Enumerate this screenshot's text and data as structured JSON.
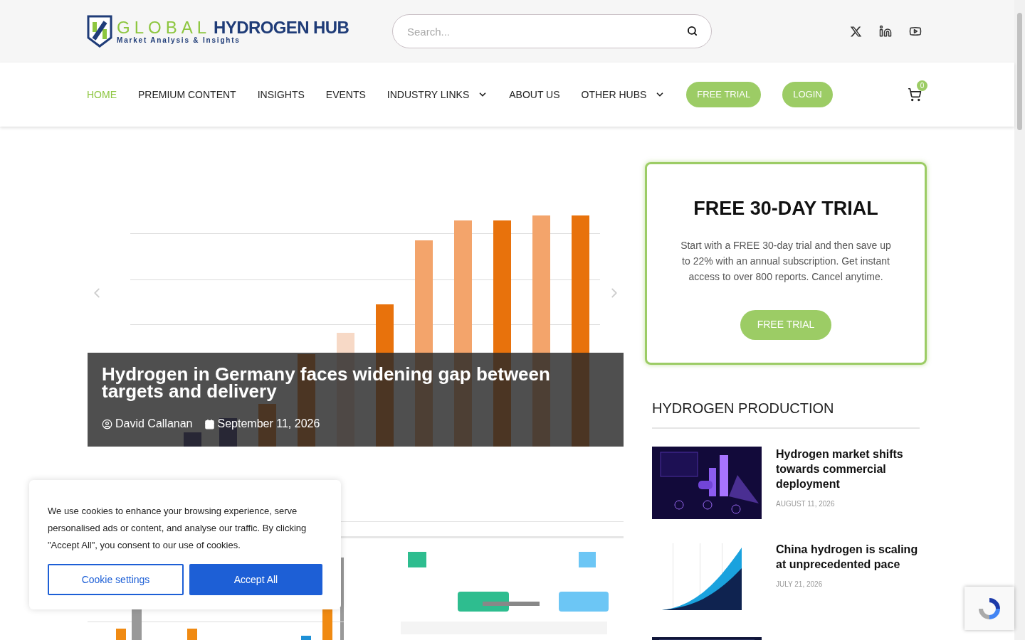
{
  "logo": {
    "word_1": "GLOBAL",
    "word_2": "HYDROGEN HUB",
    "tagline": "Market Analysis & Insights"
  },
  "search": {
    "placeholder": "Search..."
  },
  "nav": {
    "items": [
      {
        "label": "HOME",
        "selected": true,
        "dropdown": false
      },
      {
        "label": "PREMIUM CONTENT",
        "selected": false,
        "dropdown": false
      },
      {
        "label": "INSIGHTS",
        "selected": false,
        "dropdown": false
      },
      {
        "label": "EVENTS",
        "selected": false,
        "dropdown": false
      },
      {
        "label": "INDUSTRY LINKS",
        "selected": false,
        "dropdown": true
      },
      {
        "label": "ABOUT US",
        "selected": false,
        "dropdown": false
      },
      {
        "label": "OTHER HUBS",
        "selected": false,
        "dropdown": true
      }
    ],
    "buttons": [
      "FREE TRIAL",
      "LOGIN"
    ],
    "cart_count": "0"
  },
  "slide": {
    "image": {
      "kind": "picture"
    },
    "title": "Hydrogen in Germany faces widening gap between targets and delivery",
    "author": "David Callanan",
    "date": "September 11, 2026"
  },
  "second_image": {
    "kind": "picture"
  },
  "trial_card": {
    "title": "FREE 30-DAY TRIAL",
    "text": "Start with a FREE 30-day trial and then save up to 22% with an annual subscription. Get instant access to over 800 reports. Cancel anytime.",
    "button": "FREE TRIAL"
  },
  "sidebar": {
    "heading": "HYDROGEN PRODUCTION",
    "articles": [
      {
        "kind": "picture",
        "title": "Hydrogen market shifts towards commercial deployment",
        "date": "AUGUST 11, 2026"
      },
      {
        "kind": "picture",
        "title": "China hydrogen is scaling at unprecedented pace",
        "date": "JULY 21, 2026"
      },
      {
        "kind": "picture"
      }
    ]
  },
  "cookie_banner": {
    "text": "We use cookies to enhance your browsing experience, serve personalised ads or content, and analyse our traffic. By clicking \"Accept All\", you consent to our use of cookies.",
    "buttons": [
      "Cookie settings",
      "Accept All"
    ]
  }
}
